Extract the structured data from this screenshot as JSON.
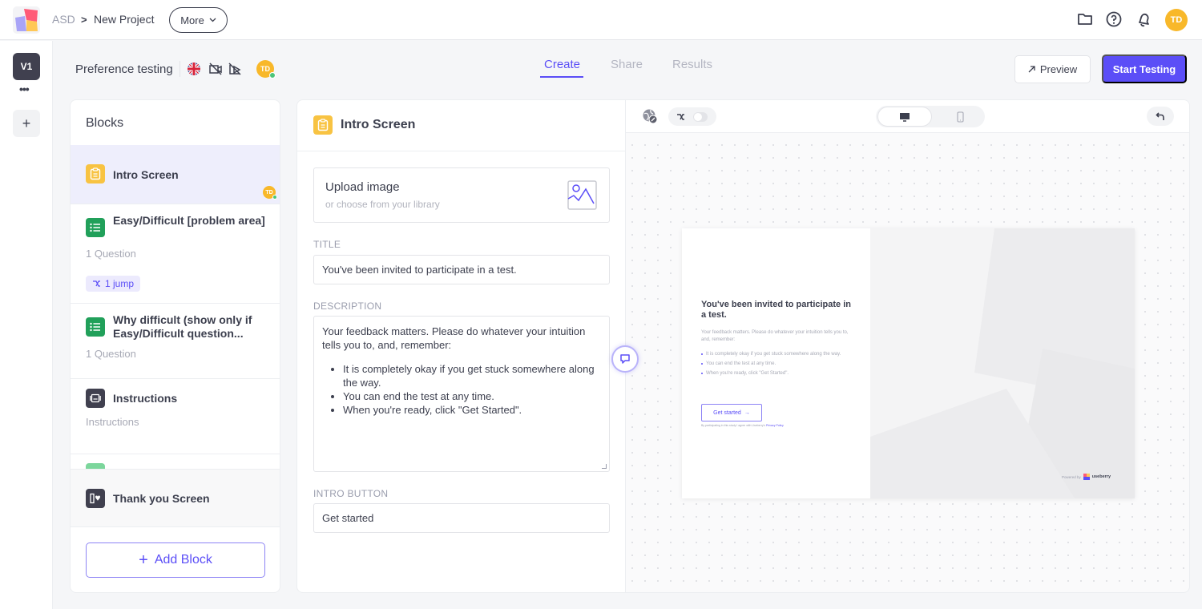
{
  "app": {
    "breadcrumb": {
      "root": "ASD",
      "separator": ">",
      "current": "New Project"
    },
    "more_label": "More",
    "user_initials": "TD"
  },
  "rail": {
    "version": "V1",
    "more": "•••",
    "add": "+"
  },
  "subheader": {
    "project_type": "Preference testing",
    "language": "English (UK)",
    "tabs": [
      {
        "label": "Create",
        "active": true
      },
      {
        "label": "Share",
        "active": false
      },
      {
        "label": "Results",
        "active": false
      }
    ],
    "preview_label": "Preview",
    "start_label": "Start Testing"
  },
  "blocks": {
    "heading": "Blocks",
    "items": [
      {
        "title": "Intro Screen",
        "type": "intro",
        "selected": true,
        "editor_initials": "TD"
      },
      {
        "title": "Easy/Difficult [problem area]",
        "type": "questions",
        "subtitle": "1 Question",
        "badge": "1 jump"
      },
      {
        "title": "Why difficult (show only if Easy/Difficult question...",
        "type": "questions",
        "subtitle": "1 Question"
      },
      {
        "title": "Instructions",
        "type": "instructions",
        "subtitle": "Instructions"
      }
    ],
    "thank_you": {
      "title": "Thank you Screen"
    },
    "add_label": "Add Block"
  },
  "editor": {
    "title": "Intro Screen",
    "upload": {
      "title": "Upload image",
      "subtitle": "or choose from your library"
    },
    "title_label": "TITLE",
    "title_value": "You've been invited to participate in a test.",
    "description_label": "DESCRIPTION",
    "description": {
      "intro": "Your feedback matters. Please do whatever your intuition tells you to, and, remember:",
      "bullets": [
        "It is completely okay if you get stuck somewhere along the way.",
        "You can end the test at any time.",
        "When you're ready, click \"Get Started\"."
      ]
    },
    "button_label": "INTRO BUTTON",
    "button_value": "Get started"
  },
  "preview": {
    "title": "You've been invited to participate in a test.",
    "description": "Your feedback matters. Please do whatever your intuition tells you to, and, remember:",
    "bullets": [
      "It is completely okay if you get stuck somewhere along the way.",
      "You can end the test at any time.",
      "When you're ready, click \"Get Started\"."
    ],
    "button": "Get started",
    "consent_text": "By participating in this study I agree with Useberry's ",
    "consent_link": "Privacy Policy",
    "powered_by": "Powered by",
    "brand": "useberry"
  },
  "colors": {
    "accent": "#5b4ef7",
    "intro_icon": "#f8c342",
    "questions_icon": "#21a05a",
    "dark_icon": "#40404f",
    "avatar": "#f8b82a"
  }
}
